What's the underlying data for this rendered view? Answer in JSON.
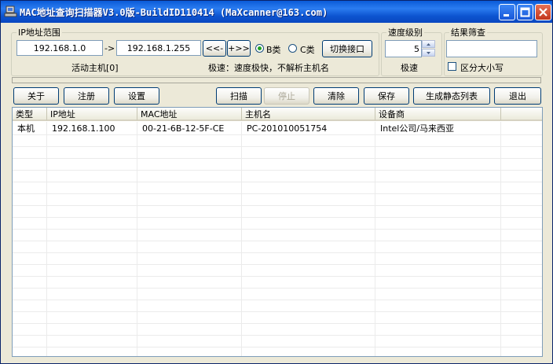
{
  "window": {
    "title": "MAC地址查询扫描器V3.0版-BuildID110414 (MaXcanner@163.com)"
  },
  "ip_range": {
    "legend": "IP地址范围",
    "start_ip": "192.168.1.0",
    "arrow": "->",
    "end_ip": "192.168.1.255",
    "prev_label": "<<-",
    "next_label": "+>>",
    "class_b_label": "B类",
    "class_c_label": "C类",
    "class_b_selected": true,
    "switch_iface_label": "切换接口",
    "active_hosts": "活动主机[0]",
    "speed_desc": "极速：速度极快，不解析主机名"
  },
  "speed": {
    "legend": "速度级别",
    "value": "5",
    "label": "极速"
  },
  "filter": {
    "legend": "结果筛查",
    "value": "",
    "case_label": "区分大小写",
    "case_checked": false
  },
  "toolbar": {
    "about": "关于",
    "register": "注册",
    "settings": "设置",
    "scan": "扫描",
    "stop": "停止",
    "clear": "清除",
    "save": "保存",
    "gen_static": "生成静态列表",
    "exit": "退出"
  },
  "table": {
    "columns": [
      "类型",
      "IP地址",
      "MAC地址",
      "主机名",
      "设备商"
    ],
    "rows": [
      [
        "本机",
        "192.168.1.100",
        "00-21-6B-12-5F-CE",
        "PC-201010051754",
        "Intel公司/马来西亚"
      ]
    ]
  },
  "colors": {
    "titlebar": "#0a5bd8",
    "face": "#ece9d8",
    "radio_dot": "#21a121"
  }
}
